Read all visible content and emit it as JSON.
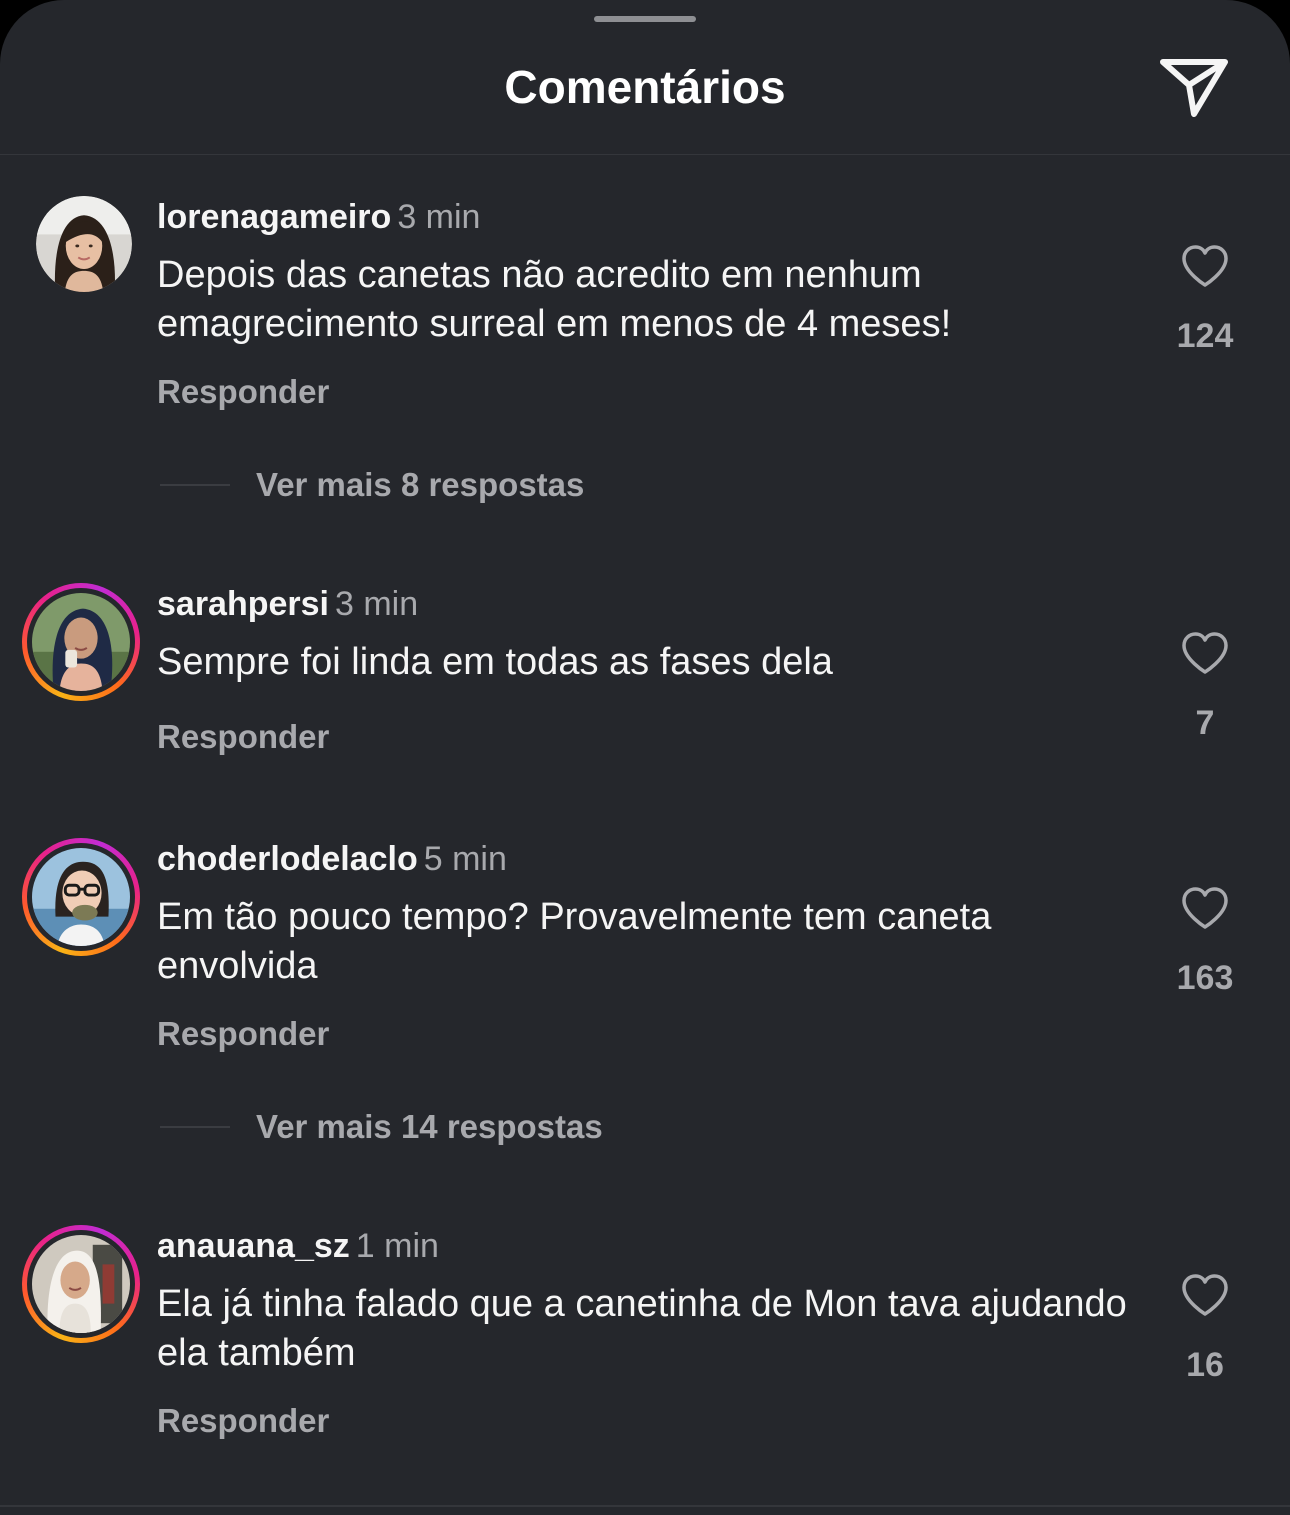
{
  "header": {
    "title": "Comentários",
    "share_icon": "paper-plane-icon"
  },
  "comments": [
    {
      "username": "lorenagameiro",
      "time": "3 min",
      "text": "Depois das canetas não acredito em nenhum emagrecimento surreal em menos de 4 meses!",
      "reply_label": "Responder",
      "likes": "124",
      "more_replies": "Ver mais 8 respostas"
    },
    {
      "username": "sarahpersi",
      "time": "3 min",
      "text": "Sempre foi linda em todas as fases dela",
      "reply_label": "Responder",
      "likes": "7"
    },
    {
      "username": "choderlodelaclo",
      "time": "5 min",
      "text": "Em tão pouco tempo? Provavelmente tem caneta envolvida",
      "reply_label": "Responder",
      "likes": "163",
      "more_replies": "Ver mais 14 respostas"
    },
    {
      "username": "anauana_sz",
      "time": "1 min",
      "text": "Ela já tinha falado que a canetinha de Mon tava ajudando ela também",
      "reply_label": "Responder",
      "likes": "16"
    }
  ],
  "colors": {
    "background": "#25272c",
    "text": "#f5f5f5",
    "muted": "#a8a9ad",
    "divider": "#34363b"
  }
}
